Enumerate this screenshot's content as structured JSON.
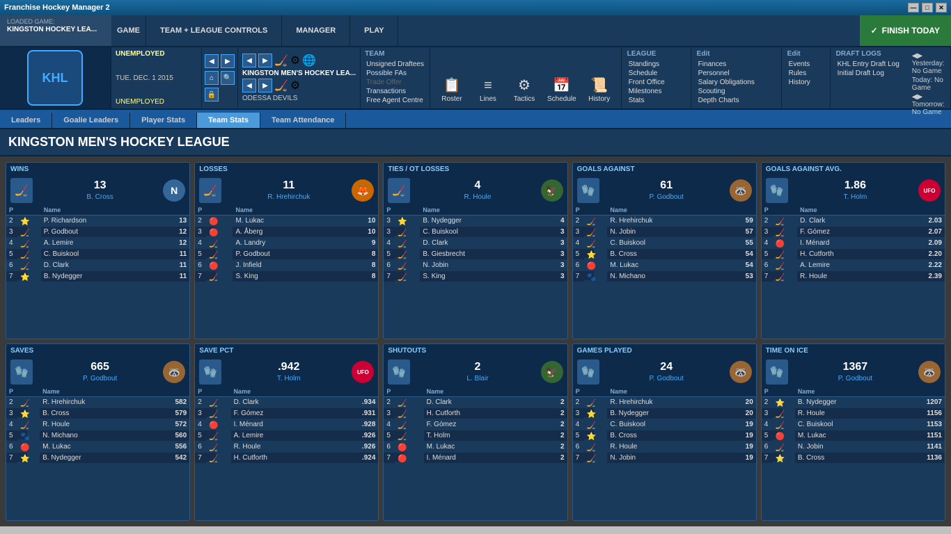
{
  "window": {
    "title": "Franchise Hockey Manager 2",
    "controls": [
      "—",
      "□",
      "✕"
    ]
  },
  "topNav": {
    "loadedGame": "LOADED GAME:",
    "gameName": "KINGSTON HOCKEY LEA...",
    "game": "GAME",
    "teamLeagueControls": "TEAM + LEAGUE CONTROLS",
    "manager": "MANAGER",
    "play": "PLAY",
    "finishToday": "FINISH TODAY"
  },
  "managerInfo": {
    "status": "UNEMPLOYED",
    "date": "TUE. DEC. 1 2015",
    "status2": "UNEMPLOYED"
  },
  "games": {
    "yesterday": "No Game",
    "today": "No Game",
    "tomorrow": "No Game"
  },
  "teamSection": {
    "team": "TEAM",
    "items": [
      "Unsigned Draftees",
      "Possible FAs",
      "Trade Offer",
      "Transactions",
      "Free Agent Centre"
    ]
  },
  "leagueSection": {
    "title": "LEAGUE",
    "items": [
      "Standings",
      "Schedule",
      "Front Office",
      "Milestones",
      "Stats"
    ]
  },
  "editSection": {
    "title": "Edit",
    "items": [
      "Finances",
      "Personnel",
      "Salary Obligations",
      "Scouting",
      "Depth Charts"
    ]
  },
  "leagueEdit": {
    "title": "Edit",
    "items": [
      "Events",
      "Rules",
      "History"
    ]
  },
  "draftLogs": {
    "title": "DRAFT LOGS",
    "items": [
      "KHL Entry Draft Log",
      "Initial Draft Log"
    ]
  },
  "mainNav": {
    "roster": "Roster",
    "lines": "Lines",
    "tactics": "Tactics",
    "schedule": "Schedule",
    "history": "History"
  },
  "teamNames": {
    "primary": "KINGSTON MEN'S HOCKEY LEA...",
    "secondary": "ODESSA DEVILS"
  },
  "tabs": {
    "leaders": "Leaders",
    "goalieLeaders": "Goalie Leaders",
    "playerStats": "Player Stats",
    "teamStats": "Team Stats",
    "teamAttendance": "Team Attendance"
  },
  "activeTab": "teamStats",
  "pageTitle": "KINGSTON MEN'S HOCKEY LEAGUE",
  "cards": [
    {
      "id": "wins",
      "title": "WINS",
      "leaderValue": "13",
      "leaderName": "B. Cross",
      "leaderAvatar": "🏒",
      "leaderLogo": "N",
      "columns": [
        "P",
        "Name",
        ""
      ],
      "rows": [
        {
          "pos": "2",
          "icon": "⭐",
          "name": "P. Richardson",
          "val": "13"
        },
        {
          "pos": "3",
          "icon": "🏒",
          "name": "P. Godbout",
          "val": "12"
        },
        {
          "pos": "4",
          "icon": "🏒",
          "name": "A. Lemire",
          "val": "12"
        },
        {
          "pos": "5",
          "icon": "🏒",
          "name": "C. Buiskool",
          "val": "11"
        },
        {
          "pos": "6",
          "icon": "🏒",
          "name": "D. Clark",
          "val": "11"
        },
        {
          "pos": "7",
          "icon": "⭐",
          "name": "B. Nydegger",
          "val": "11"
        }
      ]
    },
    {
      "id": "losses",
      "title": "LOSSES",
      "leaderValue": "11",
      "leaderName": "R. Hrehirchuk",
      "leaderAvatar": "🏒",
      "leaderLogo": "🦊",
      "columns": [
        "P",
        "Name",
        ""
      ],
      "rows": [
        {
          "pos": "2",
          "icon": "🔴",
          "name": "M. Lukac",
          "val": "10"
        },
        {
          "pos": "3",
          "icon": "🔴",
          "name": "A. Åberg",
          "val": "10"
        },
        {
          "pos": "4",
          "icon": "🏒",
          "name": "A. Landry",
          "val": "9"
        },
        {
          "pos": "5",
          "icon": "🏒",
          "name": "P. Godbout",
          "val": "8"
        },
        {
          "pos": "6",
          "icon": "🔴",
          "name": "J. Infield",
          "val": "8"
        },
        {
          "pos": "7",
          "icon": "🏒",
          "name": "S. King",
          "val": "8"
        }
      ]
    },
    {
      "id": "ties",
      "title": "TIES / OT LOSSES",
      "leaderValue": "4",
      "leaderName": "R. Houle",
      "leaderAvatar": "🏒",
      "leaderLogo": "🦅",
      "columns": [
        "P",
        "Name",
        ""
      ],
      "rows": [
        {
          "pos": "3",
          "icon": "⭐",
          "name": "B. Nydegger",
          "val": "4"
        },
        {
          "pos": "3",
          "icon": "🏒",
          "name": "C. Buiskool",
          "val": "3"
        },
        {
          "pos": "4",
          "icon": "🏒",
          "name": "D. Clark",
          "val": "3"
        },
        {
          "pos": "5",
          "icon": "🏒",
          "name": "B. Giesbrecht",
          "val": "3"
        },
        {
          "pos": "6",
          "icon": "🏒",
          "name": "N. Jobin",
          "val": "3"
        },
        {
          "pos": "7",
          "icon": "🏒",
          "name": "S. King",
          "val": "3"
        }
      ]
    },
    {
      "id": "goalsAgainst",
      "title": "GOALS AGAINST",
      "leaderValue": "61",
      "leaderName": "P. Godbout",
      "leaderAvatar": "🧤",
      "leaderLogo": "🦝",
      "columns": [
        "P",
        "Name",
        ""
      ],
      "rows": [
        {
          "pos": "2",
          "icon": "🏒",
          "name": "R. Hrehirchuk",
          "val": "59"
        },
        {
          "pos": "3",
          "icon": "🏒",
          "name": "N. Jobin",
          "val": "57"
        },
        {
          "pos": "4",
          "icon": "🏒",
          "name": "C. Buiskool",
          "val": "55"
        },
        {
          "pos": "5",
          "icon": "⭐",
          "name": "B. Cross",
          "val": "54"
        },
        {
          "pos": "6",
          "icon": "🔴",
          "name": "M. Lukac",
          "val": "54"
        },
        {
          "pos": "7",
          "icon": "🐾",
          "name": "N. Michano",
          "val": "53"
        }
      ]
    },
    {
      "id": "goalsAgainstAvg",
      "title": "GOALS AGAINST AVG.",
      "leaderValue": "1.86",
      "leaderName": "T. Holm",
      "leaderAvatar": "🧤",
      "leaderLogo": "UFO",
      "columns": [
        "P",
        "Name",
        ""
      ],
      "rows": [
        {
          "pos": "2",
          "icon": "🏒",
          "name": "D. Clark",
          "val": "2.03"
        },
        {
          "pos": "3",
          "icon": "🏒",
          "name": "F. Gómez",
          "val": "2.07"
        },
        {
          "pos": "4",
          "icon": "🔴",
          "name": "I. Ménard",
          "val": "2.09"
        },
        {
          "pos": "5",
          "icon": "🏒",
          "name": "H. Cutforth",
          "val": "2.20"
        },
        {
          "pos": "6",
          "icon": "🏒",
          "name": "A. Lemire",
          "val": "2.22"
        },
        {
          "pos": "7",
          "icon": "🏒",
          "name": "R. Houle",
          "val": "2.39"
        }
      ]
    },
    {
      "id": "saves",
      "title": "SAVES",
      "leaderValue": "665",
      "leaderName": "P. Godbout",
      "leaderAvatar": "🧤",
      "leaderLogo": "🦝",
      "columns": [
        "P",
        "Name",
        ""
      ],
      "rows": [
        {
          "pos": "2",
          "icon": "🏒",
          "name": "R. Hrehirchuk",
          "val": "582"
        },
        {
          "pos": "3",
          "icon": "⭐",
          "name": "B. Cross",
          "val": "579"
        },
        {
          "pos": "4",
          "icon": "🏒",
          "name": "R. Houle",
          "val": "572"
        },
        {
          "pos": "5",
          "icon": "🐾",
          "name": "N. Michano",
          "val": "560"
        },
        {
          "pos": "6",
          "icon": "🔴",
          "name": "M. Lukac",
          "val": "556"
        },
        {
          "pos": "7",
          "icon": "⭐",
          "name": "B. Nydegger",
          "val": "542"
        }
      ]
    },
    {
      "id": "savePct",
      "title": "SAVE PCT",
      "leaderValue": ".942",
      "leaderName": "T. Holm",
      "leaderAvatar": "🧤",
      "leaderLogo": "UFO",
      "columns": [
        "P",
        "Name",
        ""
      ],
      "rows": [
        {
          "pos": "2",
          "icon": "🏒",
          "name": "D. Clark",
          "val": ".934"
        },
        {
          "pos": "3",
          "icon": "🏒",
          "name": "F. Gómez",
          "val": ".931"
        },
        {
          "pos": "4",
          "icon": "🔴",
          "name": "I. Ménard",
          "val": ".928"
        },
        {
          "pos": "5",
          "icon": "🏒",
          "name": "A. Lemire",
          "val": ".926"
        },
        {
          "pos": "6",
          "icon": "🏒",
          "name": "R. Houle",
          "val": ".926"
        },
        {
          "pos": "7",
          "icon": "🏒",
          "name": "H. Cutforth",
          "val": ".924"
        }
      ]
    },
    {
      "id": "shutouts",
      "title": "SHUTOUTS",
      "leaderValue": "2",
      "leaderName": "L. Blair",
      "leaderAvatar": "🧤",
      "leaderLogo": "🦅",
      "columns": [
        "P",
        "Name",
        ""
      ],
      "rows": [
        {
          "pos": "2",
          "icon": "🏒",
          "name": "D. Clark",
          "val": "2"
        },
        {
          "pos": "3",
          "icon": "🏒",
          "name": "H. Cutforth",
          "val": "2"
        },
        {
          "pos": "4",
          "icon": "🏒",
          "name": "F. Gómez",
          "val": "2"
        },
        {
          "pos": "5",
          "icon": "🏒",
          "name": "T. Holm",
          "val": "2"
        },
        {
          "pos": "6",
          "icon": "🔴",
          "name": "M. Lukac",
          "val": "2"
        },
        {
          "pos": "7",
          "icon": "🔴",
          "name": "I. Ménard",
          "val": "2"
        }
      ]
    },
    {
      "id": "gamesPlayed",
      "title": "GAMES PLAYED",
      "leaderValue": "24",
      "leaderName": "P. Godbout",
      "leaderAvatar": "🧤",
      "leaderLogo": "🦝",
      "columns": [
        "P",
        "Name",
        ""
      ],
      "rows": [
        {
          "pos": "2",
          "icon": "🏒",
          "name": "R. Hrehirchuk",
          "val": "20"
        },
        {
          "pos": "3",
          "icon": "⭐",
          "name": "B. Nydegger",
          "val": "20"
        },
        {
          "pos": "4",
          "icon": "🏒",
          "name": "C. Buiskool",
          "val": "19"
        },
        {
          "pos": "5",
          "icon": "⭐",
          "name": "B. Cross",
          "val": "19"
        },
        {
          "pos": "6",
          "icon": "🏒",
          "name": "R. Houle",
          "val": "19"
        },
        {
          "pos": "7",
          "icon": "🏒",
          "name": "N. Jobin",
          "val": "19"
        }
      ]
    },
    {
      "id": "timeOnIce",
      "title": "TIME ON ICE",
      "leaderValue": "1367",
      "leaderName": "P. Godbout",
      "leaderAvatar": "🧤",
      "leaderLogo": "🦝",
      "columns": [
        "P",
        "Name",
        ""
      ],
      "rows": [
        {
          "pos": "2",
          "icon": "⭐",
          "name": "B. Nydegger",
          "val": "1207"
        },
        {
          "pos": "3",
          "icon": "🏒",
          "name": "R. Houle",
          "val": "1156"
        },
        {
          "pos": "4",
          "icon": "🏒",
          "name": "C. Buiskool",
          "val": "1153"
        },
        {
          "pos": "5",
          "icon": "🔴",
          "name": "M. Lukac",
          "val": "1151"
        },
        {
          "pos": "6",
          "icon": "🏒",
          "name": "N. Jobin",
          "val": "1141"
        },
        {
          "pos": "7",
          "icon": "⭐",
          "name": "B. Cross",
          "val": "1136"
        }
      ]
    }
  ]
}
